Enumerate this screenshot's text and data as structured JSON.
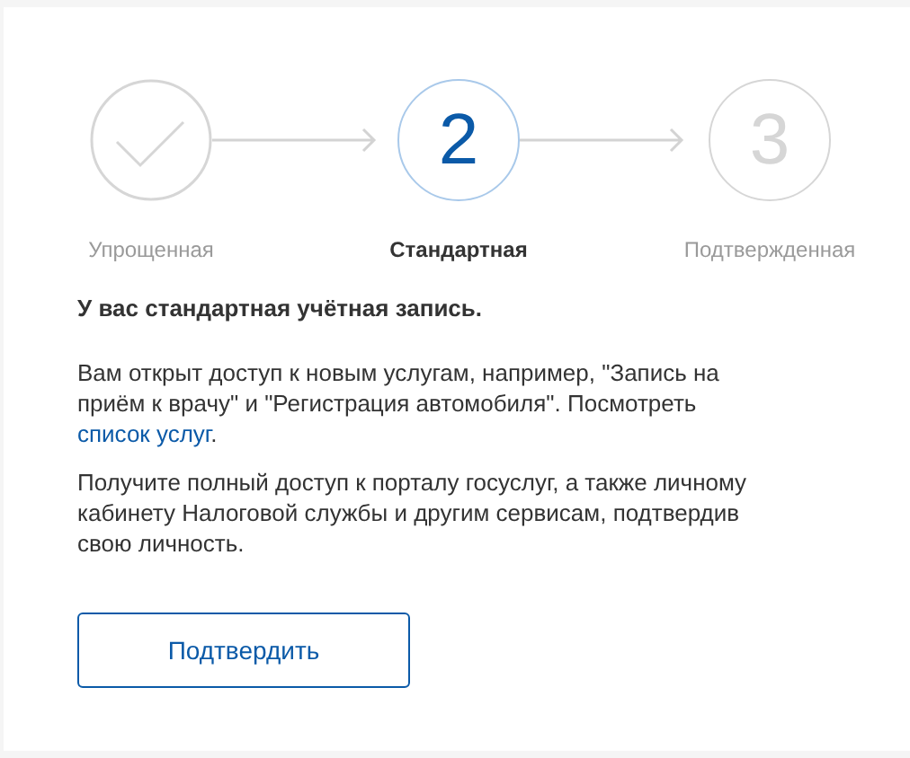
{
  "steps": [
    {
      "label": "Упрощенная",
      "completed": true,
      "selected": false
    },
    {
      "label": "Стандартная",
      "number": "2",
      "completed": false,
      "selected": true
    },
    {
      "label": "Подтвержденная",
      "number": "3",
      "completed": false,
      "selected": false
    }
  ],
  "heading": "У вас стандартная учётная запись.",
  "paragraphs": [
    {
      "text": "Вам открыт доступ к новым услугам, например, \"Запись на приём к врачу\" и \"Регистрация автомобиля\". Посмотреть",
      "link": "список услуг",
      "tail": "."
    },
    {
      "text": "Получите полный доступ к порталу госуслуг, а также личному кабинету Налоговой службы и другим сервисам, подтвердив свою личность."
    }
  ],
  "button": "Подтвердить"
}
